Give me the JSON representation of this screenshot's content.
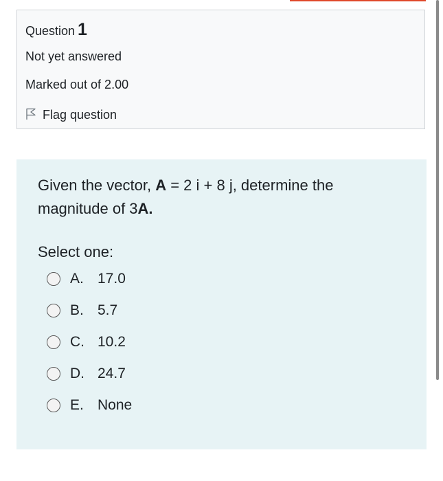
{
  "info": {
    "question_label": "Question",
    "question_number": "1",
    "state": "Not yet answered",
    "grade": "Marked out of 2.00",
    "flag_label": "Flag question"
  },
  "question": {
    "text_parts": {
      "p1": "Given the vector, ",
      "bold1": "A",
      "p2": " = 2 i + 8 j, determine the magnitude of 3",
      "bold2": "A.",
      "p3": ""
    },
    "prompt": "Select one:",
    "options": [
      {
        "letter": "A.",
        "text": "17.0"
      },
      {
        "letter": "B.",
        "text": "5.7"
      },
      {
        "letter": "C.",
        "text": "10.2"
      },
      {
        "letter": "D.",
        "text": "24.7"
      },
      {
        "letter": "E.",
        "text": "None"
      }
    ]
  },
  "colors": {
    "accent": "#e0482b",
    "content_bg": "#e7f3f5",
    "info_bg": "#f8f9fa"
  }
}
